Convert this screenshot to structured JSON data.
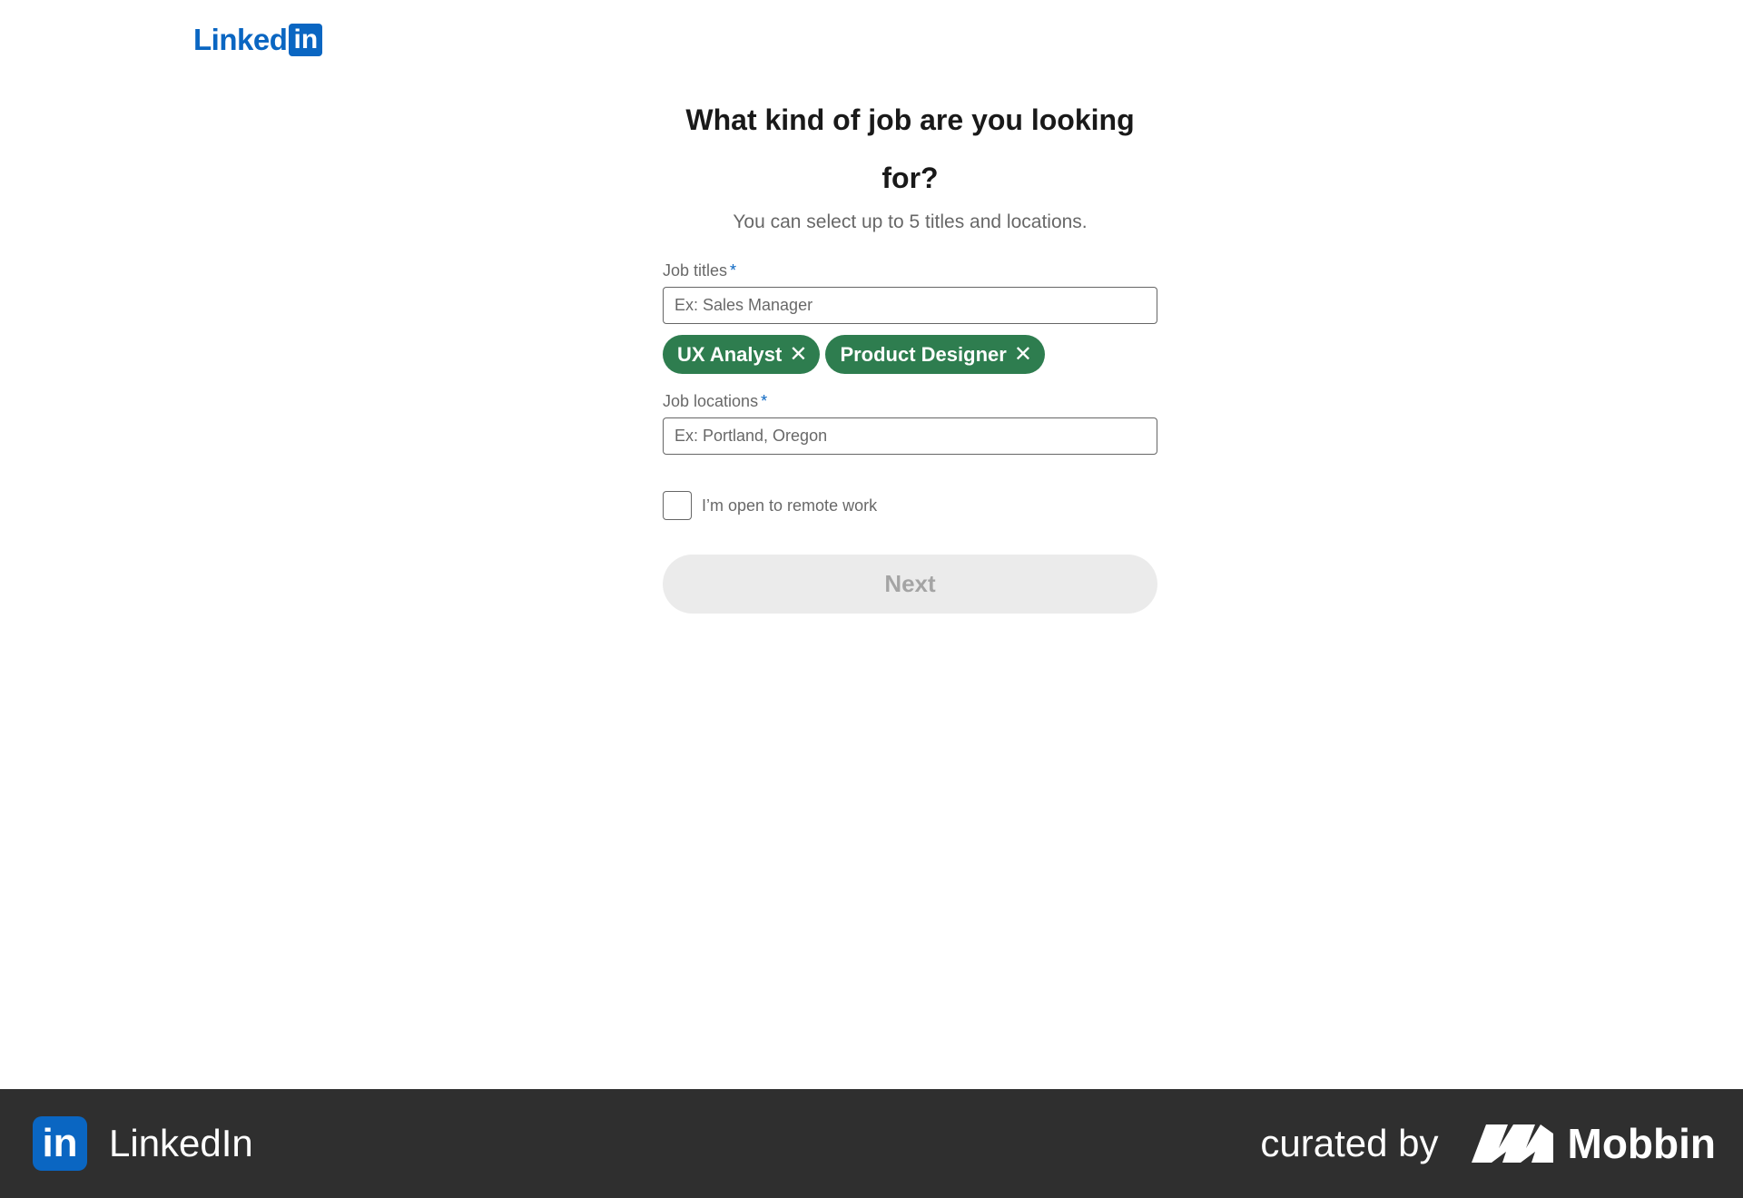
{
  "header": {
    "logo_word": "Linked",
    "logo_box": "in"
  },
  "main": {
    "title": "What kind of job are you looking for?",
    "subtitle": "You can select up to 5 titles and locations.",
    "job_titles": {
      "label": "Job titles",
      "required_mark": "*",
      "placeholder": "Ex: Sales Manager",
      "value": "",
      "chips": [
        {
          "label": "UX Analyst",
          "remove_icon": "close-icon"
        },
        {
          "label": "Product Designer",
          "remove_icon": "close-icon"
        }
      ]
    },
    "job_locations": {
      "label": "Job locations",
      "required_mark": "*",
      "placeholder": "Ex: Portland, Oregon",
      "value": ""
    },
    "remote": {
      "label": "I’m open to remote work",
      "checked": false
    },
    "next_label": "Next"
  },
  "footer": {
    "icon_text": "in",
    "brand": "LinkedIn",
    "curated_by": "curated by",
    "mobbin": "Mobbin"
  },
  "colors": {
    "brand_blue": "#0a66c2",
    "chip_green": "#2e7d4f",
    "footer_bg": "#2f2f2f",
    "disabled_btn": "#ebebeb"
  }
}
